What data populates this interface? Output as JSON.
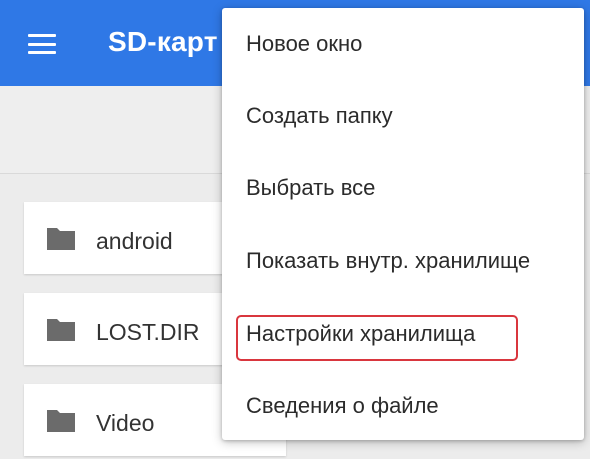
{
  "appbar": {
    "title": "SD-карт",
    "menu_icon": "hamburger-menu-icon",
    "color": "#2f78e6"
  },
  "folders": [
    {
      "name": "android",
      "icon": "folder-icon"
    },
    {
      "name": "LOST.DIR",
      "icon": "folder-icon"
    },
    {
      "name": "Video",
      "icon": "folder-icon"
    }
  ],
  "menu": {
    "items": [
      {
        "label": "Новое окно"
      },
      {
        "label": "Создать папку"
      },
      {
        "label": "Выбрать все"
      },
      {
        "label": "Показать внутр. хранилище"
      },
      {
        "label": "Настройки хранилища",
        "highlighted": true
      },
      {
        "label": "Сведения о файле"
      }
    ],
    "highlight_color": "#d9363e"
  }
}
